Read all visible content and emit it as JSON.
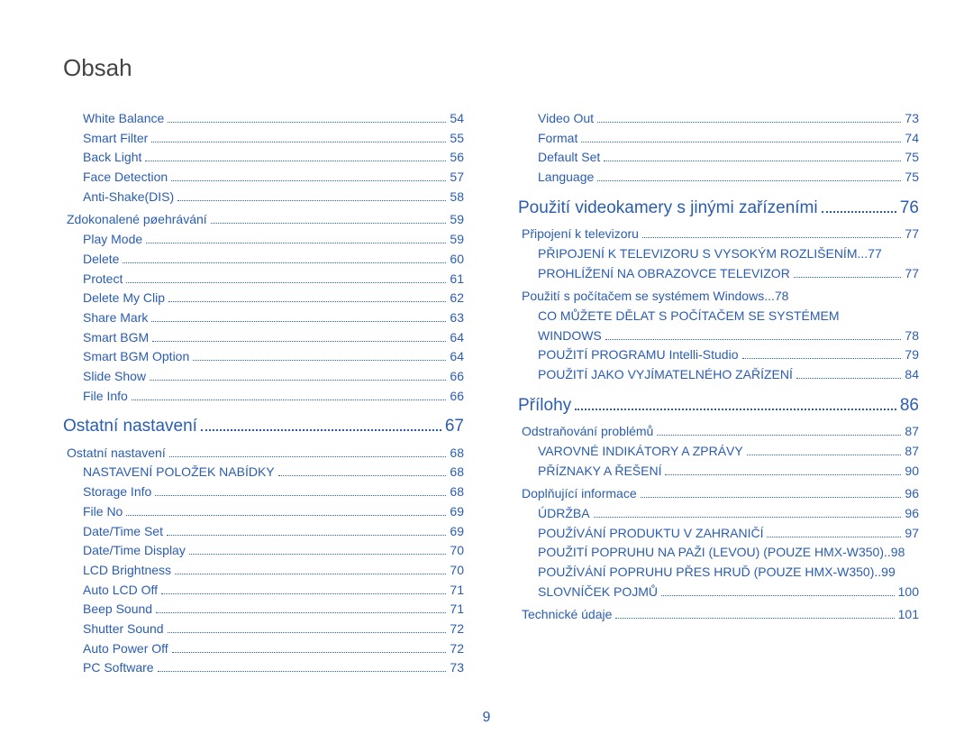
{
  "title": "Obsah",
  "footer_page": "9",
  "columns": [
    [
      {
        "level": 2,
        "label": "White Balance",
        "page": "54"
      },
      {
        "level": 2,
        "label": "Smart Filter",
        "page": "55"
      },
      {
        "level": 2,
        "label": "Back Light",
        "page": "56"
      },
      {
        "level": 2,
        "label": "Face Detection",
        "page": "57"
      },
      {
        "level": 2,
        "label": "Anti-Shake(DIS)",
        "page": "58"
      },
      {
        "level": 1,
        "label": "Zdokonalené pøehrávání",
        "page": "59"
      },
      {
        "level": 2,
        "label": "Play Mode",
        "page": "59"
      },
      {
        "level": 2,
        "label": "Delete",
        "page": "60"
      },
      {
        "level": 2,
        "label": "Protect",
        "page": "61"
      },
      {
        "level": 2,
        "label": "Delete My Clip",
        "page": "62"
      },
      {
        "level": 2,
        "label": "Share Mark",
        "page": "63"
      },
      {
        "level": 2,
        "label": "Smart BGM",
        "page": "64"
      },
      {
        "level": 2,
        "label": "Smart BGM Option",
        "page": "64"
      },
      {
        "level": 2,
        "label": "Slide Show",
        "page": "66"
      },
      {
        "level": 2,
        "label": "File Info",
        "page": "66"
      },
      {
        "level": 0,
        "label": "Ostatní nastavení",
        "page": "67"
      },
      {
        "level": 1,
        "label": "Ostatní nastavení",
        "page": "68"
      },
      {
        "level": 2,
        "label": "NASTAVENÍ POLOŽEK NABÍDKY",
        "page": "68"
      },
      {
        "level": 2,
        "label": "Storage Info",
        "page": "68"
      },
      {
        "level": 2,
        "label": "File No",
        "page": "69"
      },
      {
        "level": 2,
        "label": "Date/Time Set",
        "page": "69"
      },
      {
        "level": 2,
        "label": "Date/Time Display",
        "page": "70"
      },
      {
        "level": 2,
        "label": "LCD Brightness",
        "page": "70"
      },
      {
        "level": 2,
        "label": "Auto LCD Off",
        "page": "71"
      },
      {
        "level": 2,
        "label": "Beep Sound",
        "page": "71"
      },
      {
        "level": 2,
        "label": "Shutter Sound",
        "page": "72"
      },
      {
        "level": 2,
        "label": "Auto Power Off",
        "page": "72"
      },
      {
        "level": 2,
        "label": "PC Software",
        "page": "73"
      }
    ],
    [
      {
        "level": 2,
        "label": "Video Out",
        "page": "73"
      },
      {
        "level": 2,
        "label": "Format",
        "page": "74"
      },
      {
        "level": 2,
        "label": "Default Set",
        "page": "75"
      },
      {
        "level": 2,
        "label": "Language",
        "page": "75"
      },
      {
        "level": 0,
        "label": "Použití videokamery s jinými zařízeními",
        "page": "76"
      },
      {
        "level": 1,
        "label": "Připojení k televizoru",
        "page": "77"
      },
      {
        "level": 2,
        "label": "PŘIPOJENÍ K TELEVIZORU S VYSOKÝM ROZLIŠENÍM",
        "page": "77",
        "ellipsis": true
      },
      {
        "level": 2,
        "label": "PROHLÍŽENÍ NA OBRAZOVCE TELEVIZOR",
        "page": "77"
      },
      {
        "level": 1,
        "label": "Použití s počítačem se systémem Windows",
        "page": "78",
        "ellipsis": true
      },
      {
        "level": 2,
        "label": "CO MŮŽETE DĚLAT S POČÍTAČEM SE SYSTÉMEM",
        "page": "",
        "nodots": true
      },
      {
        "level": 2,
        "label": "WINDOWS",
        "page": "78"
      },
      {
        "level": 2,
        "label": "POUŽITÍ PROGRAMU Intelli-Studio",
        "page": "79"
      },
      {
        "level": 2,
        "label": "POUŽITÍ JAKO VYJÍMATELNÉHO ZAŘÍZENÍ",
        "page": "84"
      },
      {
        "level": 0,
        "label": "Přílohy",
        "page": "86"
      },
      {
        "level": 1,
        "label": "Odstraňování problémů",
        "page": "87"
      },
      {
        "level": 2,
        "label": "VAROVNÉ INDIKÁTORY A ZPRÁVY",
        "page": "87"
      },
      {
        "level": 2,
        "label": "PŘÍZNAKY A ŘEŠENÍ",
        "page": "90"
      },
      {
        "level": 1,
        "label": "Doplňující informace",
        "page": "96"
      },
      {
        "level": 2,
        "label": "ÚDRŽBA",
        "page": "96"
      },
      {
        "level": 2,
        "label": "POUŽÍVÁNÍ PRODUKTU V ZAHRANIČÍ",
        "page": "97"
      },
      {
        "level": 2,
        "label": "POUŽITÍ POPRUHU NA PAŽI (LEVOU) (POUZE HMX-W350)",
        "page": "98",
        "tight": true
      },
      {
        "level": 2,
        "label": "POUŽÍVÁNÍ POPRUHU PŘES HRUĎ (POUZE HMX-W350)",
        "page": "99",
        "tight": true
      },
      {
        "level": 2,
        "label": "SLOVNÍČEK POJMŮ",
        "page": "100"
      },
      {
        "level": 1,
        "label": "Technické údaje",
        "page": "101"
      }
    ]
  ]
}
